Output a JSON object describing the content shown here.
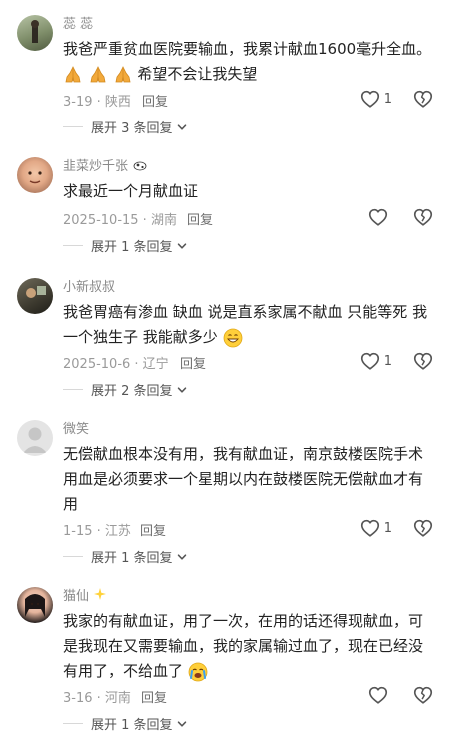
{
  "comments": [
    {
      "username": "蕊 蕊",
      "text_lines": [
        "我爸严重贫血医院要输血，我累计献血1600毫升全血。",
        "希望不会让我失望"
      ],
      "meta": "3-19 · 陕西",
      "reply_label": "回复",
      "likes": "1",
      "expand_label": "展开 3 条回复"
    },
    {
      "username": "韭菜炒千张",
      "text_lines": [
        "求最近一个月献血证"
      ],
      "meta": "2025-10-15 · 湖南",
      "reply_label": "回复",
      "likes": "",
      "expand_label": "展开 1 条回复"
    },
    {
      "username": "小新叔叔",
      "text_lines": [
        "我爸胃癌有渗血 缺血 说是直系家属不献血 只能等死 我",
        "一个独生子 我能献多少"
      ],
      "meta": "2025-10-6 · 辽宁",
      "reply_label": "回复",
      "likes": "1",
      "expand_label": "展开 2 条回复"
    },
    {
      "username": "微笑",
      "text_lines": [
        "无偿献血根本没有用，我有献血证，南京鼓楼医院手术",
        "用血是必须要求一个星期以内在鼓楼医院无偿献血才有",
        "用"
      ],
      "meta": "1-15 · 江苏",
      "reply_label": "回复",
      "likes": "1",
      "expand_label": "展开 1 条回复"
    },
    {
      "username": "猫仙",
      "text_lines": [
        "我家的有献血证，用了一次，在用的话还得现献血，可",
        "是我现在又需要输血，我的家属输过血了，现在已经没",
        "有用了，不给血了"
      ],
      "meta": "3-16 · 河南",
      "reply_label": "回复",
      "likes": "",
      "expand_label": "展开 1 条回复"
    }
  ],
  "icons": {
    "like": "heart-outline-icon",
    "dislike": "broken-heart-icon",
    "expand": "chevron-down-icon"
  },
  "colors": {
    "username": "#8a8a8a",
    "meta": "#9a9a9a",
    "text": "#222222"
  }
}
